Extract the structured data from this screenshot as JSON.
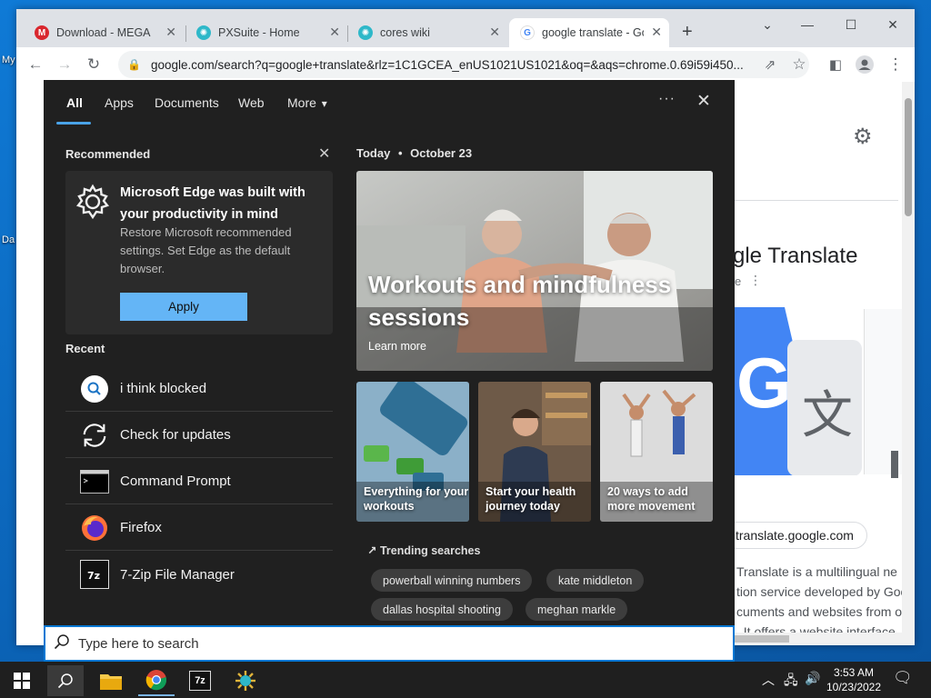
{
  "desktop": {
    "icon_label_1": "My",
    "icon_label_2": "Da"
  },
  "browser": {
    "tabs": [
      {
        "title": "Download - MEGA",
        "icon": "mega-icon",
        "color": "#d9272e"
      },
      {
        "title": "PXSuite - Home",
        "icon": "pxsuite-icon",
        "color": "#2eb8c9"
      },
      {
        "title": "cores wiki",
        "icon": "cores-icon",
        "color": "#2eb8c9"
      },
      {
        "title": "google translate - Go",
        "icon": "google-icon",
        "color": "#4285f4"
      }
    ],
    "new_tab": "+",
    "url": "google.com/search?q=google+translate&rlz=1C1GCEA_enUS1021US1021&oq=&aqs=chrome.0.69i59i450...",
    "page": {
      "heading": "gle Translate",
      "subheading": "e",
      "site": "translate.google.com",
      "desc_lines": [
        "Translate is a multilingual ne",
        "tion service developed by Goo",
        "cuments and websites from o",
        ". It offers a website interface"
      ]
    }
  },
  "start_menu": {
    "nav": [
      "All",
      "Apps",
      "Documents",
      "Web",
      "More"
    ],
    "more_arrow": "▾",
    "ellipsis": "···",
    "recommended": {
      "title": "Recommended",
      "card_title": "Microsoft Edge was built with your productivity in mind",
      "card_body": "Restore Microsoft recommended settings. Set Edge as the default browser.",
      "apply": "Apply"
    },
    "recent": {
      "title": "Recent",
      "items": [
        {
          "label": "i think blocked",
          "icon": "search-icon"
        },
        {
          "label": "Check for updates",
          "icon": "refresh-icon"
        },
        {
          "label": "Command Prompt",
          "icon": "cmd-icon"
        },
        {
          "label": "Firefox",
          "icon": "firefox-icon"
        },
        {
          "label": "7-Zip File Manager",
          "icon": "7zip-icon"
        }
      ]
    },
    "today": {
      "label": "Today",
      "separator": "•",
      "date": "October 23"
    },
    "hero": {
      "title": "Workouts and mindfulness sessions",
      "cta": "Learn more"
    },
    "tiles": [
      {
        "caption": "Everything for your workouts"
      },
      {
        "caption": "Start your health journey today"
      },
      {
        "caption": "20 ways to add more movement"
      }
    ],
    "trending": {
      "title": "Trending searches",
      "chips": [
        "powerball winning numbers",
        "kate middleton",
        "dallas hospital shooting",
        "meghan markle"
      ]
    }
  },
  "search": {
    "placeholder": "Type here to search"
  },
  "taskbar": {
    "time": "3:53 AM",
    "date": "10/23/2022",
    "zip_label": "7z"
  }
}
